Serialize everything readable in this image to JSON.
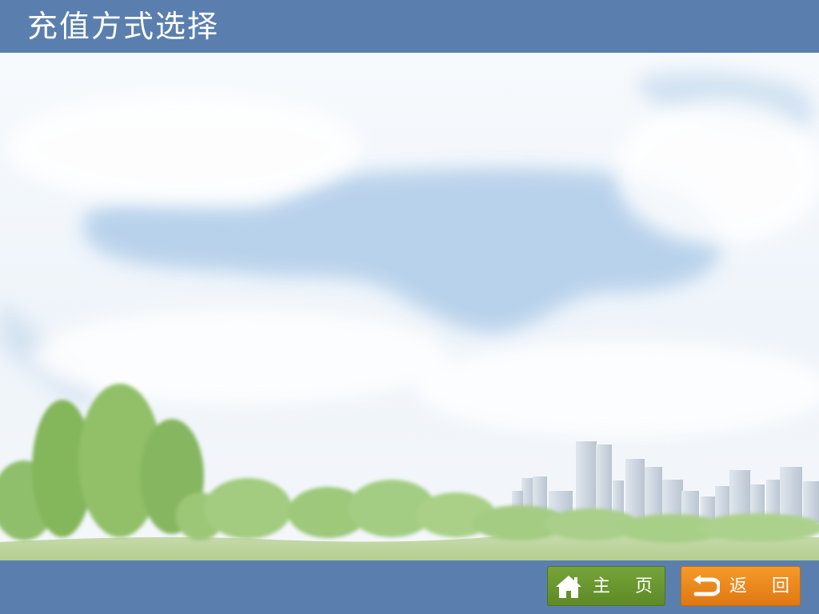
{
  "header": {
    "title": "充值方式选择"
  },
  "footer": {
    "home_button": {
      "label": "主 页",
      "icon": "home-icon"
    },
    "back_button": {
      "label": "返 回",
      "icon": "return-arrow-icon"
    }
  },
  "colors": {
    "bar": "#5a7fae",
    "home_button": "#6b9630",
    "back_button": "#ec8a1c",
    "sky_cloud_blue": "#b8d2ea"
  }
}
